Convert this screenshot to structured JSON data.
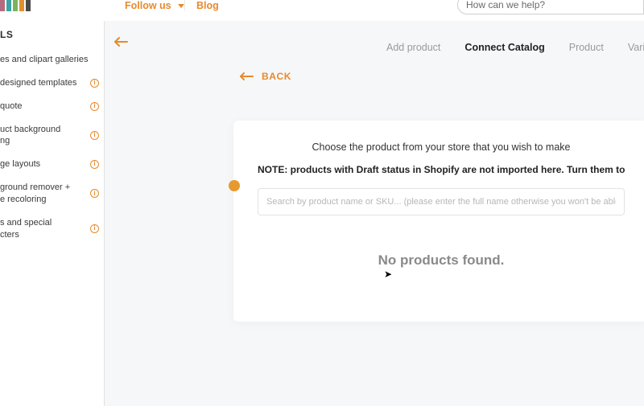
{
  "header": {
    "follow_label": "Follow us",
    "blog_label": "Blog",
    "search_placeholder": "How can we help?",
    "search_value": ""
  },
  "sidebar": {
    "title_fragment": "LS",
    "items": [
      {
        "label": "es and clipart galleries",
        "info": false
      },
      {
        "label": "designed templates",
        "info": true
      },
      {
        "label": "quote",
        "info": true
      },
      {
        "label": "uct background\nng",
        "info": true
      },
      {
        "label": "ge layouts",
        "info": true
      },
      {
        "label": "ground remover +\ne recoloring",
        "info": true
      },
      {
        "label": "s and special\ncters",
        "info": true
      }
    ]
  },
  "tabs": {
    "items": [
      {
        "id": "add-product",
        "label": "Add product",
        "active": false
      },
      {
        "id": "connect-catalog",
        "label": "Connect Catalog",
        "active": true
      },
      {
        "id": "product",
        "label": "Product",
        "active": false
      },
      {
        "id": "variation",
        "label": "Variatio",
        "active": false
      }
    ]
  },
  "back": {
    "label": "BACK"
  },
  "panel": {
    "lead": "Choose the product from your store that you wish to make",
    "note": "NOTE: products with Draft status in Shopify are not imported here. Turn them to",
    "search_placeholder": "Search by product name or SKU... (please enter the full name otherwise you won't be able to find",
    "search_value": "",
    "empty_message": "No products found."
  },
  "colors": {
    "accent": "#e68a2e"
  }
}
